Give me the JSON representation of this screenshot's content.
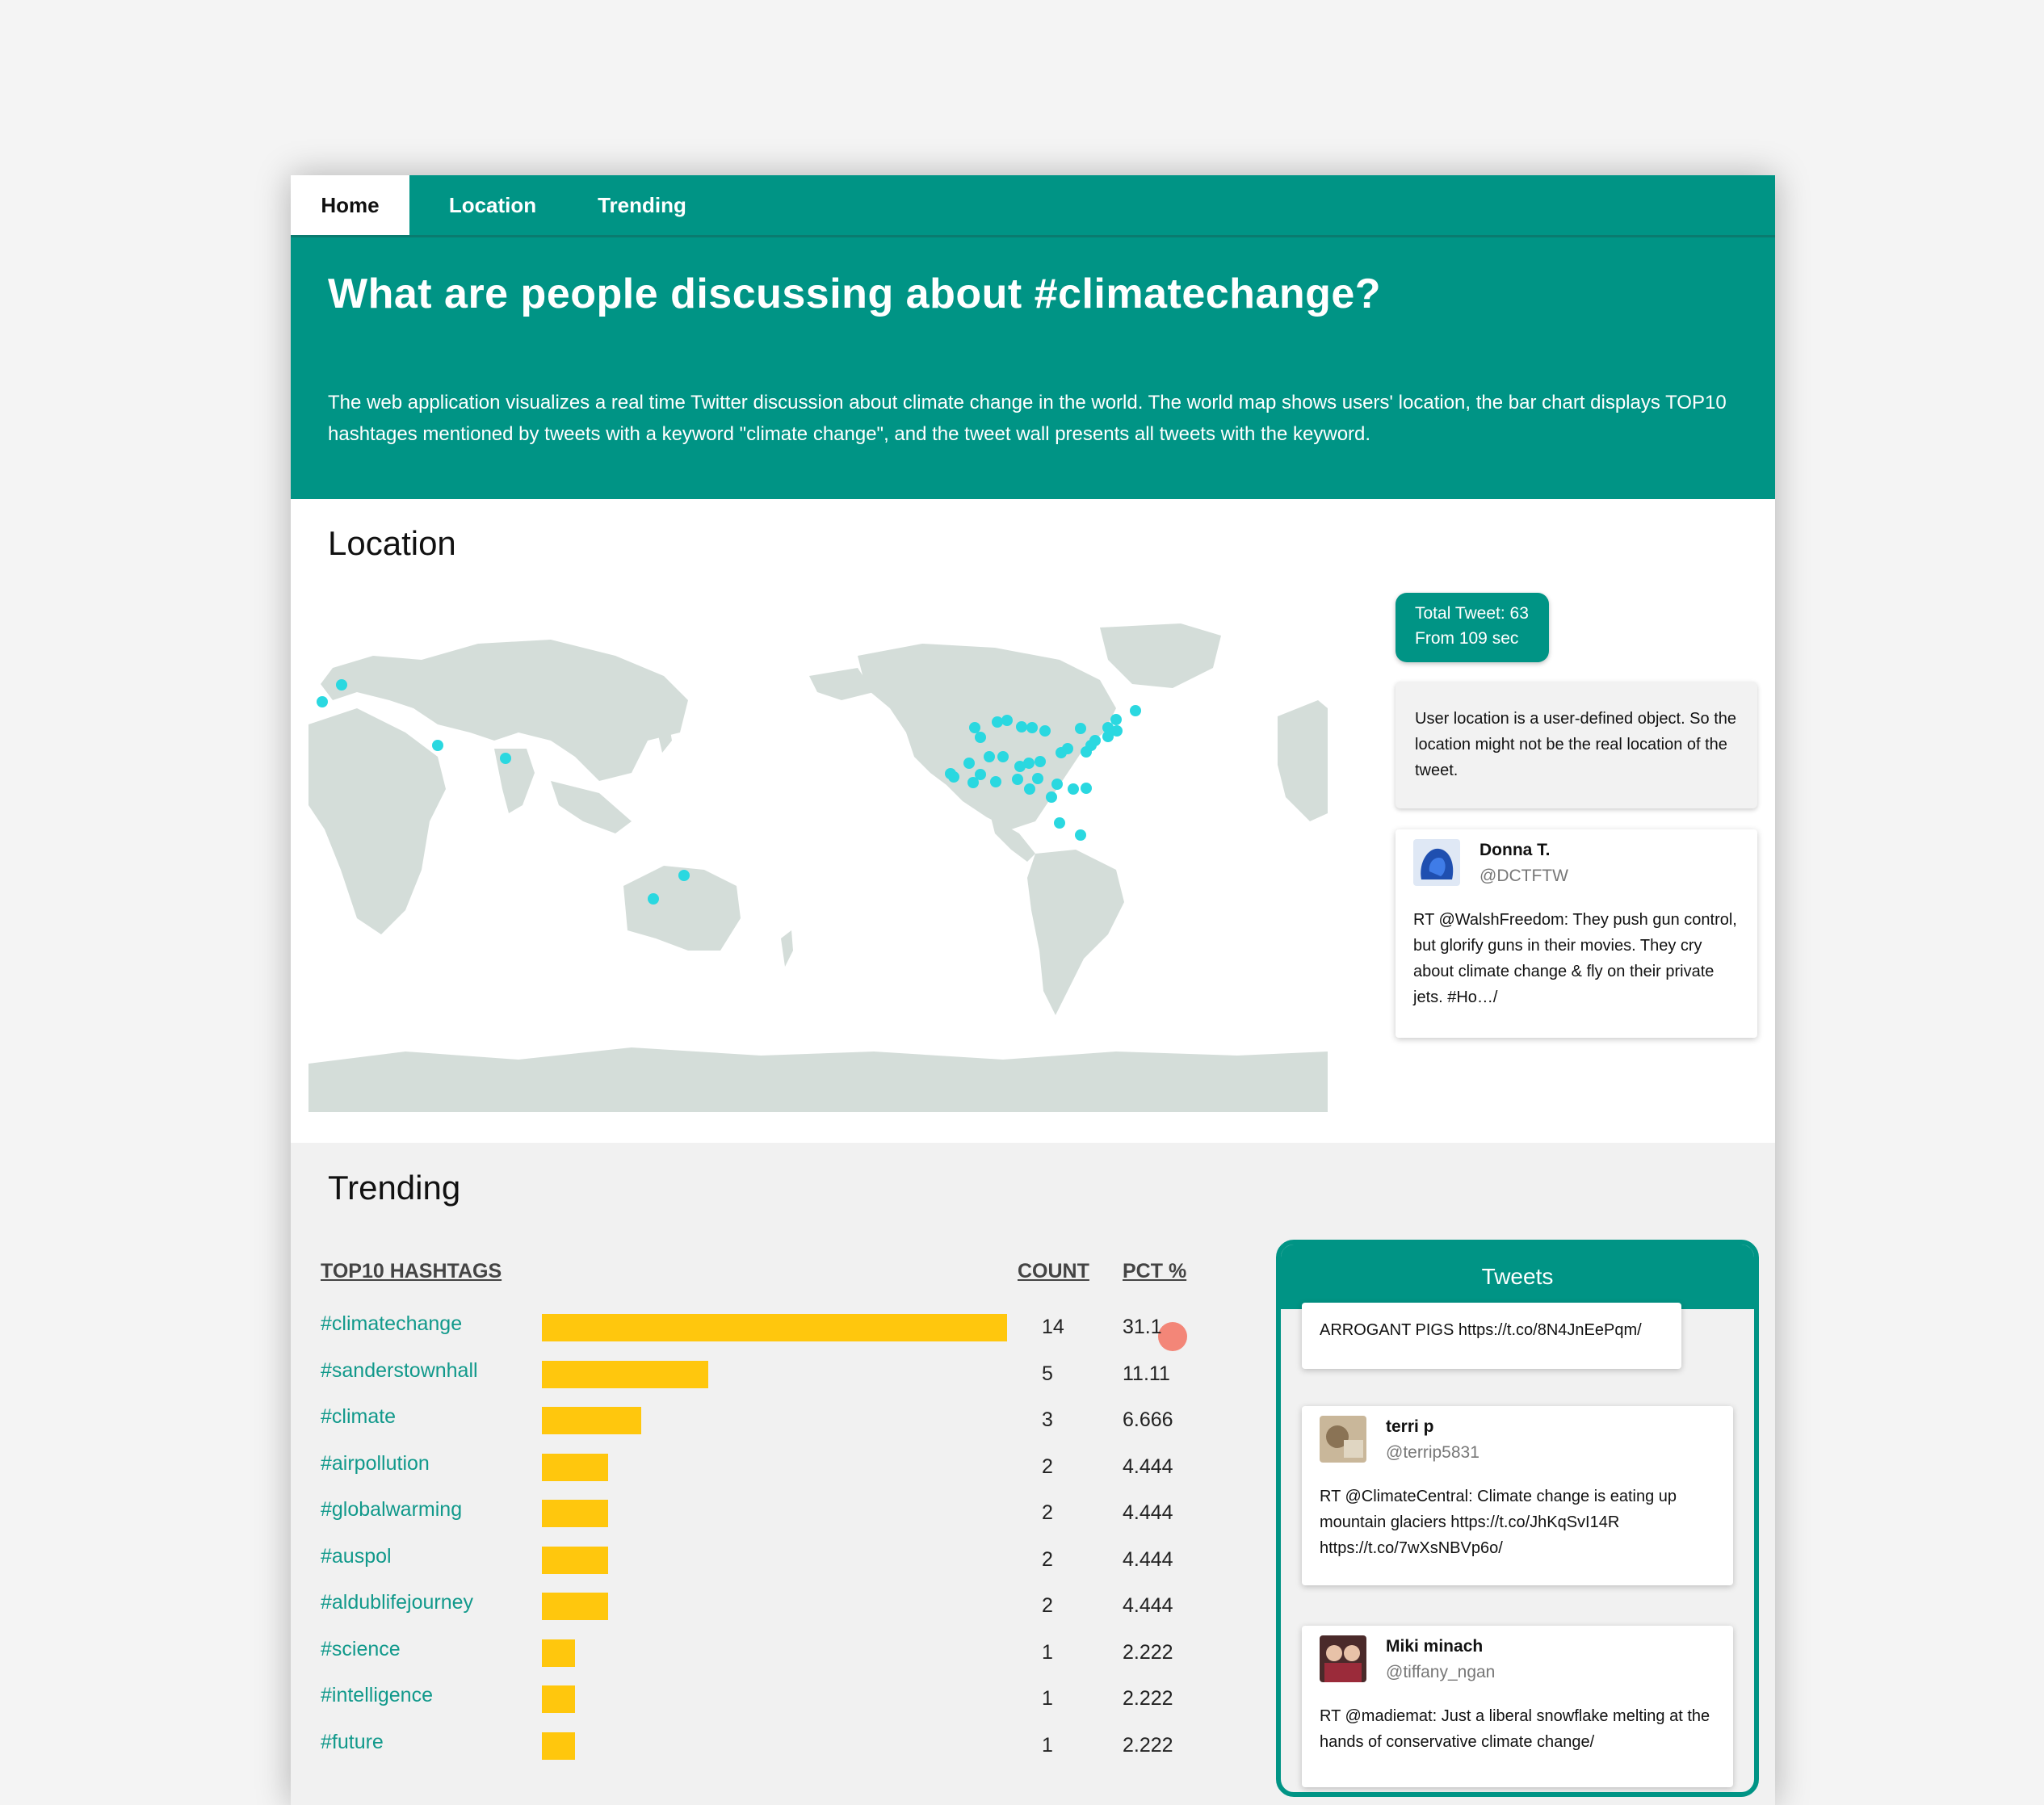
{
  "nav": {
    "home": "Home",
    "location": "Location",
    "trending": "Trending"
  },
  "hero": {
    "title": "What are people discussing about #climatechange?",
    "description": "The web application visualizes a real time Twitter discussion about climate change in the world. The world map shows users' location, the bar chart displays TOP10 hashtages mentioned by tweets with a keyword \"climate change\", and the tweet wall presents all tweets with the keyword."
  },
  "location": {
    "title": "Location",
    "stats": {
      "total": "Total Tweet: 63",
      "duration": "From 109 sec"
    },
    "note": "User location is a user-defined object. So the location might not be the real location of the tweet.",
    "tweet": {
      "name": "Donna T.",
      "handle": "@DCTFTW",
      "text": "RT @WalshFreedom: They push gun control, but glorify guns in their movies. They cry about climate change & fly on their private jets. #Ho…/"
    },
    "colors": {
      "land": "#d4ddd9",
      "dot": "#2ad8e0"
    }
  },
  "trending": {
    "title": "Trending",
    "headers": {
      "hashtags": "TOP10 HASHTAGS",
      "count": "COUNT",
      "pct": "PCT %"
    },
    "rows": [
      {
        "tag": "#climatechange",
        "count": "14",
        "pct": "31.1"
      },
      {
        "tag": "#sanderstownhall",
        "count": "5",
        "pct": "11.11"
      },
      {
        "tag": "#climate",
        "count": "3",
        "pct": "6.666"
      },
      {
        "tag": "#airpollution",
        "count": "2",
        "pct": "4.444"
      },
      {
        "tag": "#globalwarming",
        "count": "2",
        "pct": "4.444"
      },
      {
        "tag": "#auspol",
        "count": "2",
        "pct": "4.444"
      },
      {
        "tag": "#aldublifejourney",
        "count": "2",
        "pct": "4.444"
      },
      {
        "tag": "#science",
        "count": "1",
        "pct": "2.222"
      },
      {
        "tag": "#intelligence",
        "count": "1",
        "pct": "2.222"
      },
      {
        "tag": "#future",
        "count": "1",
        "pct": "2.222"
      }
    ],
    "bar_color": "#ffc70d"
  },
  "chart_data": {
    "type": "bar",
    "categories": [
      "#climatechange",
      "#sanderstownhall",
      "#climate",
      "#airpollution",
      "#globalwarming",
      "#auspol",
      "#aldublifejourney",
      "#science",
      "#intelligence",
      "#future"
    ],
    "values": [
      14,
      5,
      3,
      2,
      2,
      2,
      2,
      1,
      1,
      1
    ],
    "title": "TOP10 HASHTAGS"
  },
  "tweets_panel": {
    "title": "Tweets",
    "first": {
      "text": "ARROGANT PIGS https://t.co/8N4JnEePqm/"
    },
    "items": [
      {
        "name": "terri p",
        "handle": "@terrip5831",
        "text": "RT @ClimateCentral: Climate change is eating up mountain glaciers https://t.co/JhKqSvI14R https://t.co/7wXsNBVp6o/"
      },
      {
        "name": "Miki minach",
        "handle": "@tiffany_ngan",
        "text": "RT @madiemat: Just a liberal snowflake melting at the hands of conservative climate change/"
      }
    ]
  },
  "brand_color": "#009485"
}
